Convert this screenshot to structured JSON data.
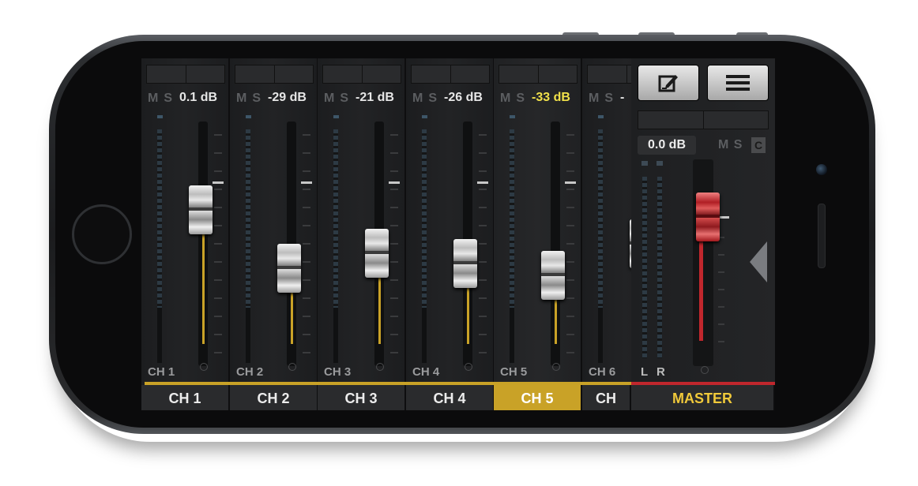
{
  "channels": [
    {
      "ms_m": "M",
      "ms_s": "S",
      "level": "0.1 dB",
      "label": "CH 1",
      "tab": "CH 1",
      "highlight": false,
      "fader_pos": 0.36
    },
    {
      "ms_m": "M",
      "ms_s": "S",
      "level": "-29 dB",
      "label": "CH 2",
      "tab": "CH 2",
      "highlight": false,
      "fader_pos": 0.6
    },
    {
      "ms_m": "M",
      "ms_s": "S",
      "level": "-21 dB",
      "label": "CH 3",
      "tab": "CH 3",
      "highlight": false,
      "fader_pos": 0.54
    },
    {
      "ms_m": "M",
      "ms_s": "S",
      "level": "-26 dB",
      "label": "CH 4",
      "tab": "CH 4",
      "highlight": false,
      "fader_pos": 0.58
    },
    {
      "ms_m": "M",
      "ms_s": "S",
      "level": "-33 dB",
      "label": "CH 5",
      "tab": "CH 5",
      "highlight": true,
      "fader_pos": 0.63
    },
    {
      "ms_m": "M",
      "ms_s": "S",
      "level": "-",
      "label": "CH 6",
      "tab": "CH",
      "highlight": false,
      "fader_pos": 0.5
    }
  ],
  "master": {
    "level": "0.0 dB",
    "ms": "M S",
    "c_label": "C",
    "left_label": "L",
    "right_label": "R",
    "tab": "MASTER"
  },
  "buttons": {
    "edit_icon": "edit-icon",
    "menu_icon": "menu-icon"
  },
  "colors": {
    "accent": "#c9a227",
    "highlight_text": "#f0e04a",
    "master_red": "#c0272d",
    "master_tab_text": "#f0c93a"
  }
}
